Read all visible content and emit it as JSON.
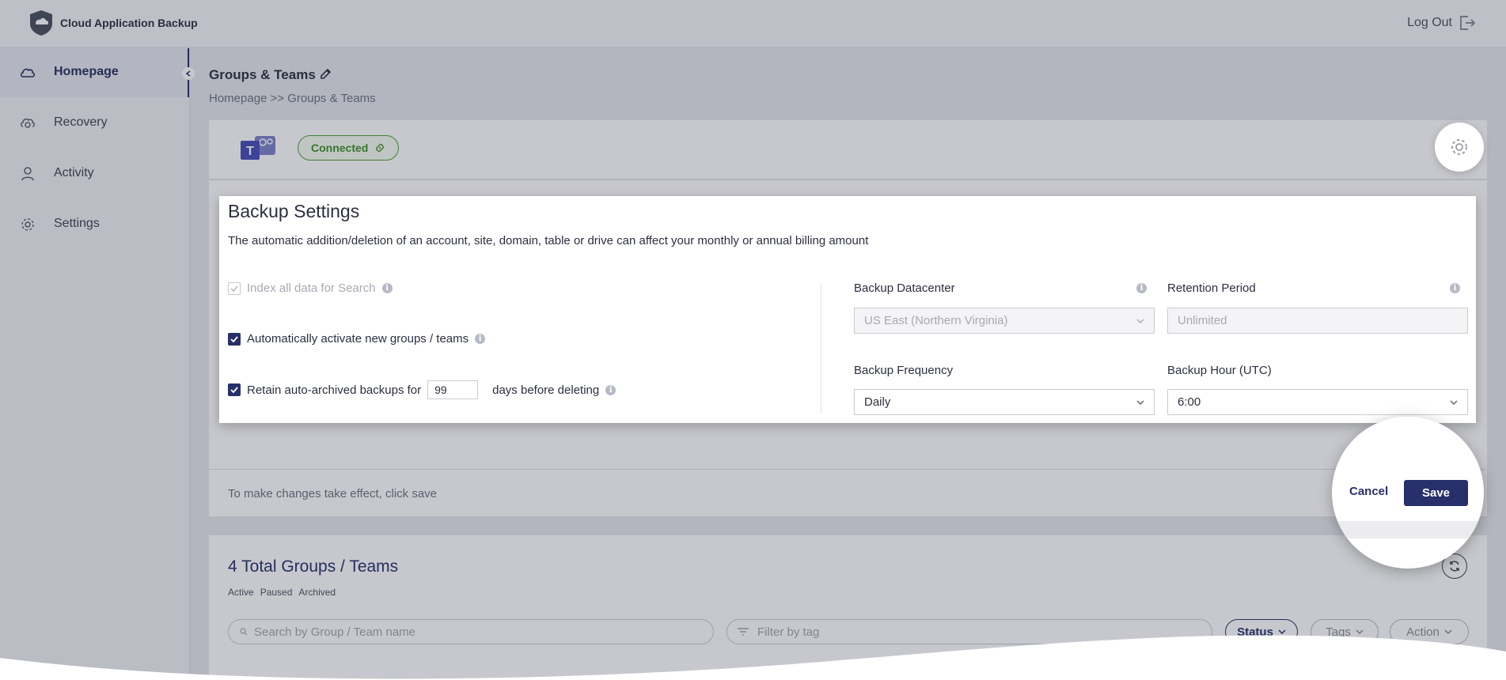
{
  "app": {
    "name": "Cloud Application Backup",
    "logout_label": "Log Out"
  },
  "sidebar": {
    "items": [
      {
        "label": "Homepage",
        "icon": "cloud-icon"
      },
      {
        "label": "Recovery",
        "icon": "cloud-restore-icon"
      },
      {
        "label": "Activity",
        "icon": "user-icon"
      },
      {
        "label": "Settings",
        "icon": "gear-icon"
      }
    ]
  },
  "page": {
    "title": "Groups & Teams",
    "breadcrumb": "Homepage >> Groups & Teams",
    "connection_status": "Connected",
    "save_hint": "To make changes take effect, click save"
  },
  "backup_settings": {
    "title": "Backup Settings",
    "description": "The automatic addition/deletion of an account, site, domain, table or drive can affect your monthly or annual billing amount",
    "index_label": "Index all data for Search",
    "auto_activate_label": "Automatically activate new groups / teams",
    "retain_label": "Retain auto-archived backups for",
    "retain_days": "99",
    "retain_suffix": "days before deleting",
    "datacenter_label": "Backup Datacenter",
    "datacenter_value": "US East (Northern Virginia)",
    "retention_label": "Retention Period",
    "retention_placeholder": "Unlimited",
    "frequency_label": "Backup Frequency",
    "frequency_value": "Daily",
    "hour_label": "Backup Hour (UTC)",
    "hour_value": "6:00"
  },
  "actions": {
    "cancel": "Cancel",
    "save": "Save"
  },
  "groups": {
    "total": "4 Total Groups / Teams",
    "tabs": [
      "Active",
      "Paused",
      "Archived"
    ],
    "search_placeholder": "Search by Group / Team name",
    "tag_placeholder": "Filter by tag",
    "status_label": "Status",
    "tags_label": "Tags",
    "action_label": "Action"
  },
  "colors": {
    "primary": "#27306a",
    "connected": "#4aa032"
  }
}
